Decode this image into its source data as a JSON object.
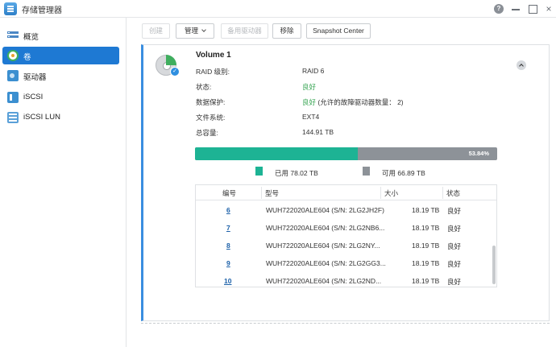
{
  "window": {
    "title": "存储管理器",
    "help_label": "?",
    "close_label": "×"
  },
  "sidebar": {
    "items": [
      {
        "label": "概览",
        "icon": "overview-icon"
      },
      {
        "label": "卷",
        "icon": "volume-icon",
        "active": true
      },
      {
        "label": "驱动器",
        "icon": "drive-icon"
      },
      {
        "label": "iSCSI",
        "icon": "iscsi-icon"
      },
      {
        "label": "iSCSI LUN",
        "icon": "iscsi-lun-icon"
      }
    ]
  },
  "toolbar": {
    "create_label": "创建",
    "manage_label": "管理",
    "hot_spare_label": "备用驱动器",
    "remove_label": "移除",
    "snapshot_label": "Snapshot Center"
  },
  "volume": {
    "name": "Volume 1",
    "check_mark": "✓",
    "properties": [
      {
        "label": "RAID 级别:",
        "value": "RAID 6"
      },
      {
        "label": "状态:",
        "value": "良好",
        "status": "ok"
      },
      {
        "label": "数据保护:",
        "value": "良好",
        "value_suffix": "(允许的故障驱动器数量： 2)",
        "status": "ok"
      },
      {
        "label": "文件系统:",
        "value": "EXT4"
      },
      {
        "label": "总容量:",
        "value": "144.91 TB"
      }
    ],
    "usage": {
      "used_percent": 53.84,
      "percent_label": "53.84%",
      "used_label": "已用 78.02 TB",
      "available_label": "可用 66.89 TB"
    }
  },
  "disks": {
    "columns": [
      "编号",
      "型号",
      "大小",
      "状态"
    ],
    "rows": [
      {
        "no": "6",
        "model": "WUH722020ALE604 (S/N: 2LG2JH2F)",
        "size": "18.19 TB",
        "status": "良好"
      },
      {
        "no": "7",
        "model": "WUH722020ALE604 (S/N: 2LG2NB6...",
        "size": "18.19 TB",
        "status": "良好"
      },
      {
        "no": "8",
        "model": "WUH722020ALE604 (S/N: 2LG2NY...",
        "size": "18.19 TB",
        "status": "良好"
      },
      {
        "no": "9",
        "model": "WUH722020ALE604 (S/N: 2LG2GG3...",
        "size": "18.19 TB",
        "status": "良好"
      },
      {
        "no": "10",
        "model": "WUH722020ALE604 (S/N: 2LG2ND...",
        "size": "18.19 TB",
        "status": "良好"
      }
    ]
  },
  "colors": {
    "accent": "#1e79d3",
    "ok": "#3aa655",
    "used": "#1db394",
    "available": "#8d9298"
  }
}
